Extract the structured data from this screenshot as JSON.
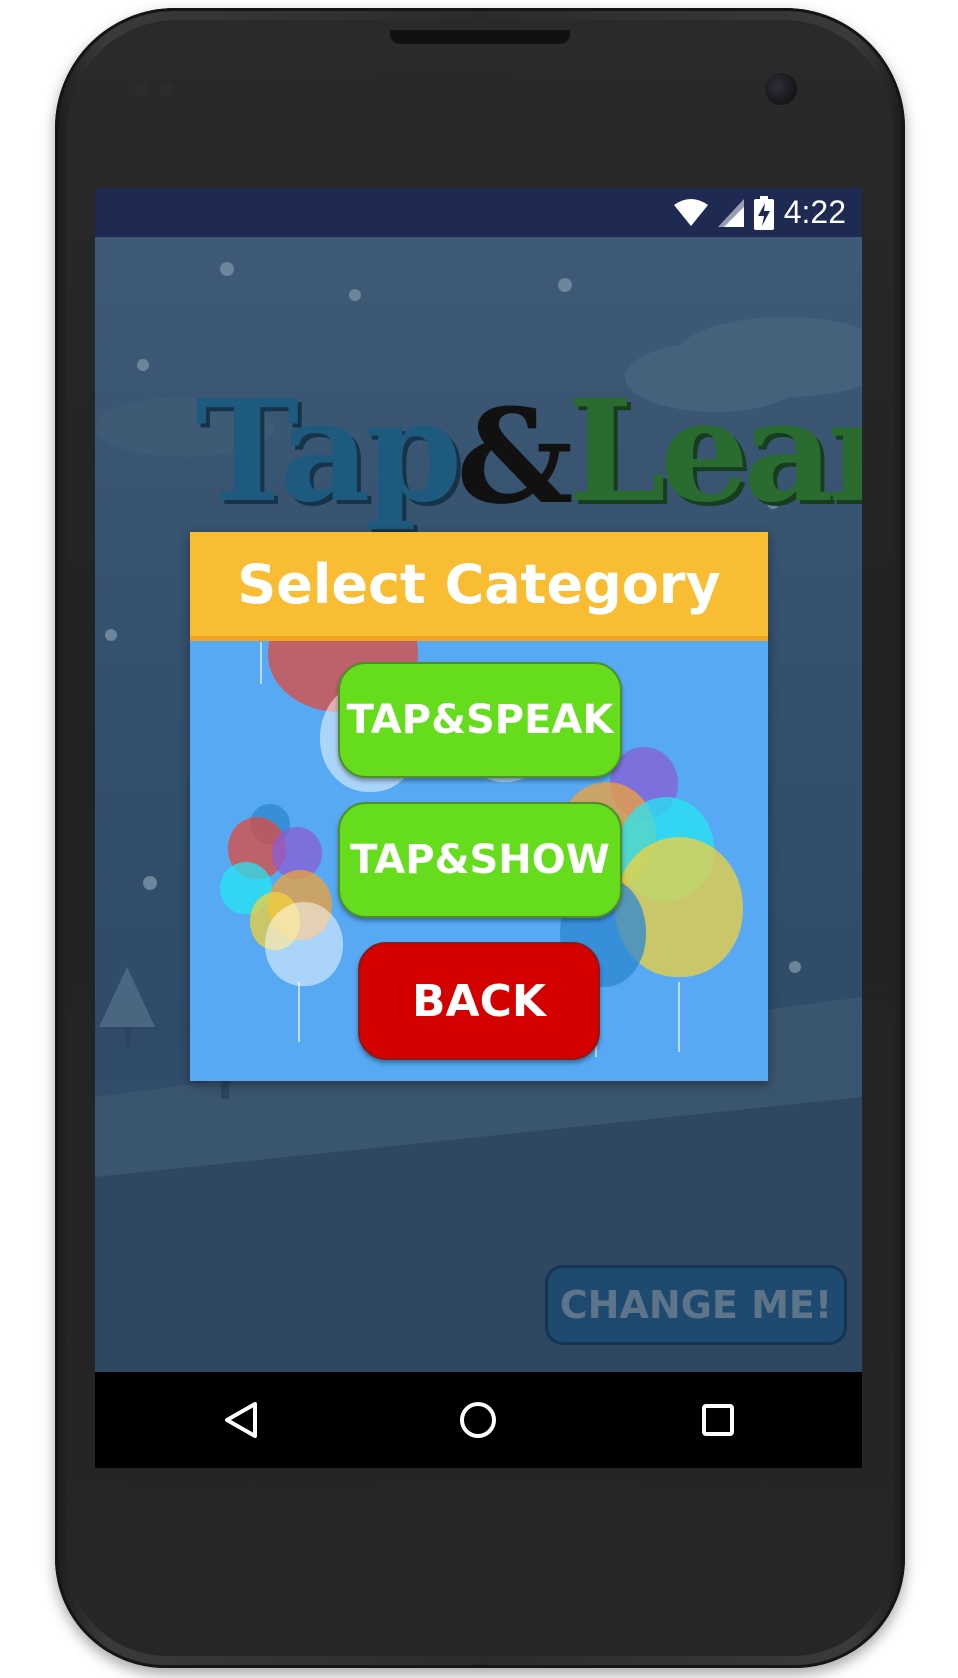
{
  "status_bar": {
    "time": "4:22",
    "icons": [
      "wifi-icon",
      "cell-signal-icon",
      "battery-charging-icon"
    ]
  },
  "app": {
    "logo": {
      "part1": "Tap",
      "part2": "&",
      "part3": "Learn"
    },
    "background_button": "CHANGE ME!"
  },
  "dialog": {
    "title": "Select Category",
    "buttons": [
      {
        "label": "TAP&SPEAK",
        "color": "#66dd1c"
      },
      {
        "label": "TAP&SHOW",
        "color": "#66dd1c"
      },
      {
        "label": "BACK",
        "color": "#d40000"
      }
    ],
    "header_color": "#f9bd33",
    "body_color": "#56a9f2"
  },
  "nav_bar": {
    "icons": [
      "back-triangle-icon",
      "home-circle-icon",
      "recents-square-icon"
    ]
  }
}
